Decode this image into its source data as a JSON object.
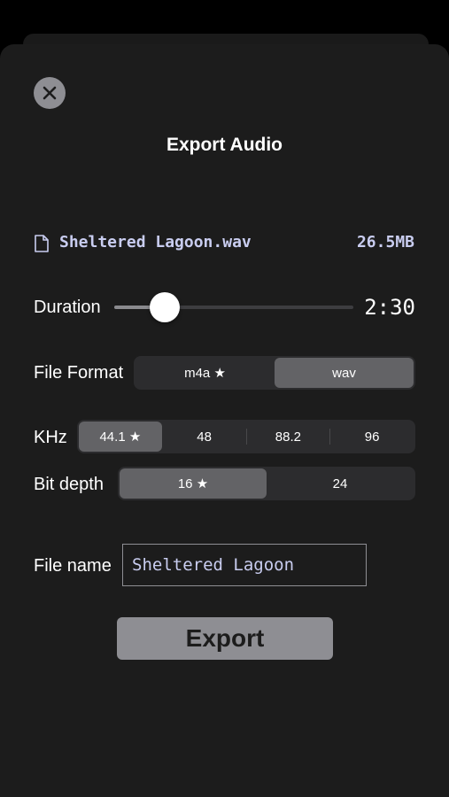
{
  "title": "Export Audio",
  "file": {
    "name": "Sheltered Lagoon.wav",
    "size": "26.5MB",
    "icon": "document-icon"
  },
  "duration": {
    "label": "Duration",
    "value": "2:30",
    "slider_fraction": 0.21
  },
  "file_format": {
    "label": "File Format",
    "options": [
      "m4a ★",
      "wav"
    ],
    "selected": "wav"
  },
  "khz": {
    "label": "KHz",
    "options": [
      "44.1 ★",
      "48",
      "88.2",
      "96"
    ],
    "selected": "44.1 ★"
  },
  "bit_depth": {
    "label": "Bit depth",
    "options": [
      "16 ★",
      "24"
    ],
    "selected": "16 ★"
  },
  "file_name": {
    "label": "File name",
    "value": "Sheltered Lagoon"
  },
  "export_label": "Export",
  "colors": {
    "accent_text": "#c9cdf0",
    "button_gray": "#8e8e93",
    "background": "#1c1c1c"
  }
}
